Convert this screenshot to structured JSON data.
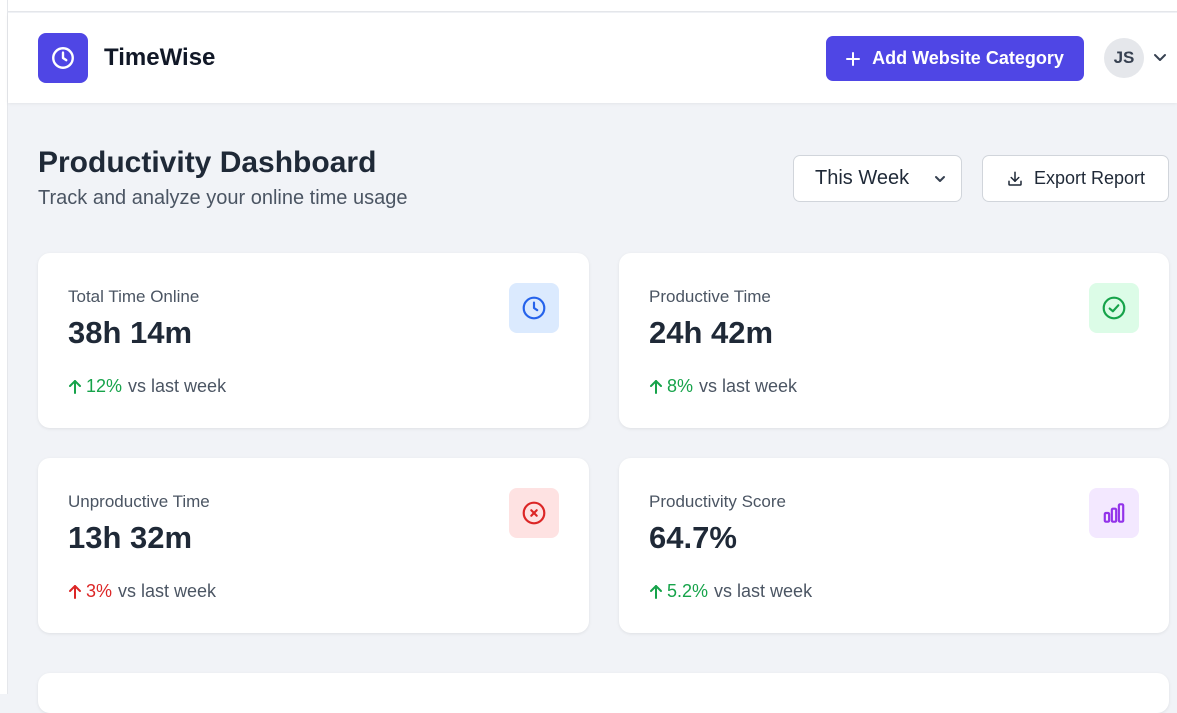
{
  "app": {
    "brand": "TimeWise",
    "accent_color": "#4f46e5"
  },
  "header": {
    "add_button_label": "Add Website Category",
    "avatar_initials": "JS"
  },
  "page": {
    "title": "Productivity Dashboard",
    "subtitle": "Track and analyze your online time usage",
    "period_select": "This Week",
    "export_label": "Export Report"
  },
  "stats": [
    {
      "label": "Total Time Online",
      "value": "38h 14m",
      "change": "12%",
      "direction": "up",
      "change_color": "#16a34a",
      "compare": "vs last week",
      "icon": "clock-icon",
      "icon_bg": "#dbeafe",
      "icon_color": "#2563eb"
    },
    {
      "label": "Productive Time",
      "value": "24h 42m",
      "change": "8%",
      "direction": "up",
      "change_color": "#16a34a",
      "compare": "vs last week",
      "icon": "check-circle-icon",
      "icon_bg": "#dcfce7",
      "icon_color": "#16a34a"
    },
    {
      "label": "Unproductive Time",
      "value": "13h 32m",
      "change": "3%",
      "direction": "up",
      "change_color": "#dc2626",
      "compare": "vs last week",
      "icon": "x-circle-icon",
      "icon_bg": "#fee2e2",
      "icon_color": "#dc2626"
    },
    {
      "label": "Productivity Score",
      "value": "64.7%",
      "change": "5.2%",
      "direction": "up",
      "change_color": "#16a34a",
      "compare": "vs last week",
      "icon": "bar-chart-icon",
      "icon_bg": "#f3e8ff",
      "icon_color": "#9333ea"
    }
  ]
}
